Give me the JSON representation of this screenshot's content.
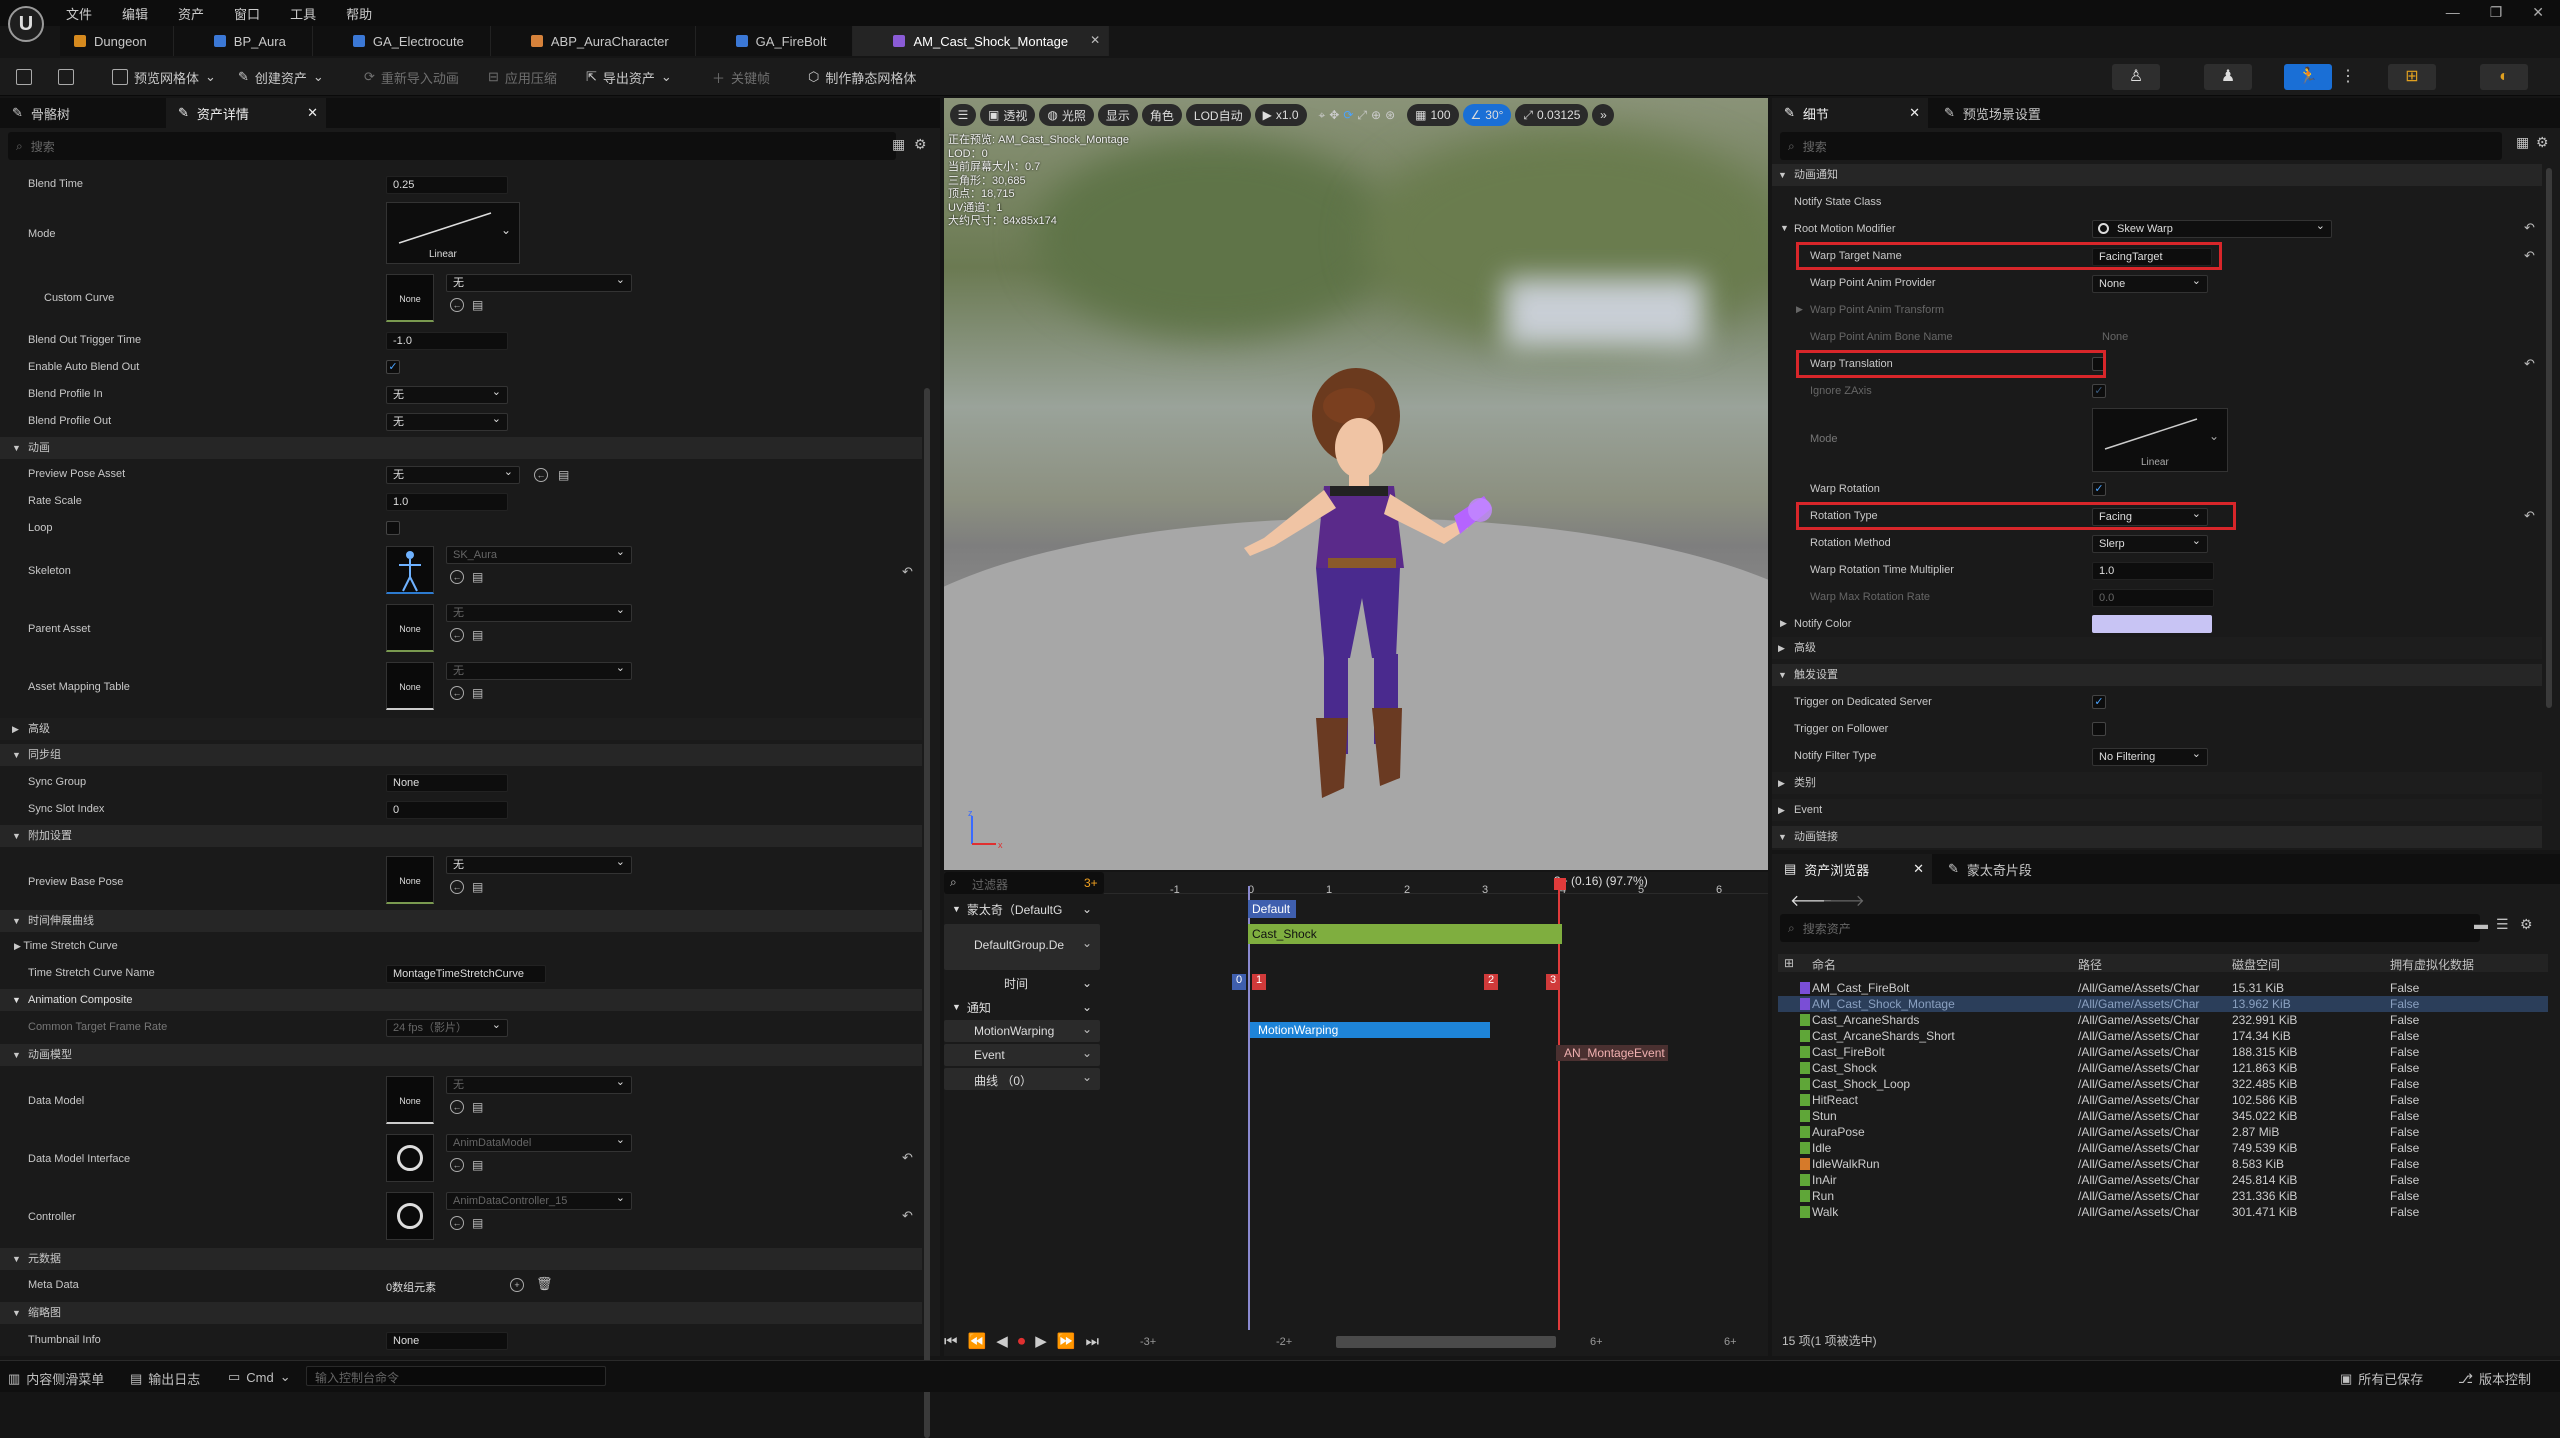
{
  "menu": {
    "items": [
      "文件",
      "编辑",
      "资产",
      "窗口",
      "工具",
      "帮助"
    ]
  },
  "tabs": [
    {
      "label": "Dungeon",
      "color": "#d68a1e"
    },
    {
      "label": "BP_Aura",
      "color": "#3b78d6"
    },
    {
      "label": "GA_Electrocute",
      "color": "#3b78d6"
    },
    {
      "label": "ABP_AuraCharacter",
      "color": "#d6823b"
    },
    {
      "label": "GA_FireBolt",
      "color": "#3b78d6"
    },
    {
      "label": "AM_Cast_Shock_Montage",
      "color": "#8a5bd6"
    }
  ],
  "toolbar": {
    "preview_mesh": "预览网格体",
    "create_asset": "创建资产",
    "reimport": "重新导入动画",
    "apply_compression": "应用压缩",
    "export_asset": "导出资产",
    "keyframe": "关键帧",
    "make_static_mesh": "制作静态网格体"
  },
  "left_panel": {
    "tab_skeleton": "骨骼树",
    "tab_details": "资产详情",
    "search_placeholder": "搜索",
    "blend_time_label": "Blend Time",
    "blend_time": "0.25",
    "mode_label": "Mode",
    "mode_value": "Linear",
    "custom_curve_label": "Custom Curve",
    "none_label": "None",
    "none_cn": "无",
    "blend_out_trigger_label": "Blend Out Trigger Time",
    "blend_out_trigger": "-1.0",
    "auto_blend_out_label": "Enable Auto Blend Out",
    "blend_profile_in_label": "Blend Profile In",
    "blend_profile_out_label": "Blend Profile Out",
    "cat_animation": "动画",
    "preview_pose_label": "Preview Pose Asset",
    "rate_scale_label": "Rate Scale",
    "rate_scale": "1.0",
    "loop_label": "Loop",
    "skeleton_label": "Skeleton",
    "skeleton_value": "SK_Aura",
    "parent_asset_label": "Parent Asset",
    "asset_mapping_label": "Asset Mapping Table",
    "cat_advanced": "高级",
    "cat_sync": "同步组",
    "sync_group_label": "Sync Group",
    "sync_group": "None",
    "sync_slot_label": "Sync Slot Index",
    "sync_slot": "0",
    "cat_additive": "附加设置",
    "preview_base_pose_label": "Preview Base Pose",
    "cat_time_stretch": "时间伸展曲线",
    "time_stretch_curve_label": "Time Stretch Curve",
    "time_stretch_name_label": "Time Stretch Curve Name",
    "time_stretch_name": "MontageTimeStretchCurve",
    "cat_anim_composite": "Animation Composite",
    "common_frame_rate_label": "Common Target Frame Rate",
    "common_frame_rate": "24 fps（影片）",
    "cat_anim_model": "动画模型",
    "data_model_label": "Data Model",
    "data_model_interface_label": "Data Model Interface",
    "data_model_interface": "AnimDataModel",
    "controller_label": "Controller",
    "controller": "AnimDataController_15",
    "cat_metadata": "元数据",
    "meta_data_label": "Meta Data",
    "meta_data_value": "0数组元素",
    "cat_thumbnail": "缩略图",
    "thumbnail_info_label": "Thumbnail Info",
    "thumbnail_info": "None"
  },
  "viewport": {
    "menu_icon": "hamburger-icon",
    "perspective": "透视",
    "lit": "光照",
    "show": "显示",
    "character": "角色",
    "lod_auto": "LOD自动",
    "play_rate": "x1.0",
    "grid_size": "100",
    "rotation_snap": "30°",
    "camera_speed": "0.03125",
    "stats": [
      "正在预览: AM_Cast_Shock_Montage",
      "LOD：0",
      "当前屏幕大小：0.7",
      "三角形：30,685",
      "顶点：18,715",
      "UV通道：1",
      "大约尺寸：84x85x174"
    ]
  },
  "timeline": {
    "filter_placeholder": "过滤器",
    "filter_count": "3+",
    "montage_track": "蒙太奇（DefaultG",
    "group_track": "DefaultGroup.De",
    "time_track": "时间",
    "notify_track": "通知",
    "motion_warping_track": "MotionWarping",
    "event_track": "Event",
    "curves_track": "曲线 （0）",
    "default_label": "Default",
    "segment_label": "Cast_Shock",
    "notify_state": "MotionWarping",
    "notify_event": "AN_MontageEvent",
    "playhead_label": "3+ (0.16) (97.7%)",
    "ruler_ticks": [
      "-1",
      "0",
      "1",
      "2",
      "3",
      "4",
      "5",
      "6"
    ],
    "section_markers": [
      "0",
      "1",
      "2",
      "3"
    ],
    "transport_labels": [
      "-3+",
      "-2+",
      "6+",
      "6+"
    ]
  },
  "details": {
    "tab_details": "细节",
    "tab_preview_settings": "预览场景设置",
    "search_placeholder": "搜索",
    "cat_anim_notify": "动画通知",
    "notify_state_class_label": "Notify State Class",
    "root_motion_label": "Root Motion Modifier",
    "root_motion_value": "Skew Warp",
    "warp_target_name_label": "Warp Target Name",
    "warp_target_name": "FacingTarget",
    "warp_point_provider_label": "Warp Point Anim Provider",
    "warp_point_provider": "None",
    "warp_point_transform_label": "Warp Point Anim Transform",
    "warp_point_bone_label": "Warp Point Anim Bone Name",
    "warp_point_bone": "None",
    "warp_translation_label": "Warp Translation",
    "ignore_z_label": "Ignore ZAxis",
    "mode_label": "Mode",
    "mode_value": "Linear",
    "warp_rotation_label": "Warp Rotation",
    "rotation_type_label": "Rotation Type",
    "rotation_type": "Facing",
    "rotation_method_label": "Rotation Method",
    "rotation_method": "Slerp",
    "rotation_time_mult_label": "Warp Rotation Time Multiplier",
    "rotation_time_mult": "1.0",
    "max_rotation_rate_label": "Warp Max Rotation Rate",
    "max_rotation_rate": "0.0",
    "notify_color_label": "Notify Color",
    "notify_color": "#c8c4f4",
    "cat_advanced": "高级",
    "cat_trigger": "触发设置",
    "trigger_dedicated_label": "Trigger on Dedicated Server",
    "trigger_follower_label": "Trigger on Follower",
    "notify_filter_label": "Notify Filter Type",
    "notify_filter": "No Filtering",
    "cat_category": "类别",
    "cat_event": "Event",
    "cat_anim_link": "动画链接"
  },
  "asset_browser": {
    "tab_browser": "资产浏览器",
    "tab_montage_sections": "蒙太奇片段",
    "search_placeholder": "搜索资产",
    "col_name": "命名",
    "col_path": "路径",
    "col_size": "磁盘空间",
    "col_virtualized": "拥有虚拟化数据",
    "footer": "15 项(1 项被选中)",
    "rows": [
      {
        "name": "AM_Cast_FireBolt",
        "path": "/All/Game/Assets/Char",
        "size": "15.31 KiB",
        "virt": "False",
        "color": "#7a4ed6"
      },
      {
        "name": "AM_Cast_Shock_Montage",
        "path": "/All/Game/Assets/Char",
        "size": "13.962 KiB",
        "virt": "False",
        "color": "#7a4ed6"
      },
      {
        "name": "Cast_ArcaneShards",
        "path": "/All/Game/Assets/Char",
        "size": "232.991 KiB",
        "virt": "False",
        "color": "#5fa638"
      },
      {
        "name": "Cast_ArcaneShards_Short",
        "path": "/All/Game/Assets/Char",
        "size": "174.34 KiB",
        "virt": "False",
        "color": "#5fa638"
      },
      {
        "name": "Cast_FireBolt",
        "path": "/All/Game/Assets/Char",
        "size": "188.315 KiB",
        "virt": "False",
        "color": "#5fa638"
      },
      {
        "name": "Cast_Shock",
        "path": "/All/Game/Assets/Char",
        "size": "121.863 KiB",
        "virt": "False",
        "color": "#5fa638"
      },
      {
        "name": "Cast_Shock_Loop",
        "path": "/All/Game/Assets/Char",
        "size": "322.485 KiB",
        "virt": "False",
        "color": "#5fa638"
      },
      {
        "name": "HitReact",
        "path": "/All/Game/Assets/Char",
        "size": "102.586 KiB",
        "virt": "False",
        "color": "#5fa638"
      },
      {
        "name": "Stun",
        "path": "/All/Game/Assets/Char",
        "size": "345.022 KiB",
        "virt": "False",
        "color": "#5fa638"
      },
      {
        "name": "AuraPose",
        "path": "/All/Game/Assets/Char",
        "size": "2.87 MiB",
        "virt": "False",
        "color": "#5fa638"
      },
      {
        "name": "Idle",
        "path": "/All/Game/Assets/Char",
        "size": "749.539 KiB",
        "virt": "False",
        "color": "#5fa638"
      },
      {
        "name": "IdleWalkRun",
        "path": "/All/Game/Assets/Char",
        "size": "8.583 KiB",
        "virt": "False",
        "color": "#d67a2a"
      },
      {
        "name": "InAir",
        "path": "/All/Game/Assets/Char",
        "size": "245.814 KiB",
        "virt": "False",
        "color": "#5fa638"
      },
      {
        "name": "Run",
        "path": "/All/Game/Assets/Char",
        "size": "231.336 KiB",
        "virt": "False",
        "color": "#5fa638"
      },
      {
        "name": "Walk",
        "path": "/All/Game/Assets/Char",
        "size": "301.471 KiB",
        "virt": "False",
        "color": "#5fa638"
      }
    ]
  },
  "statusbar": {
    "content_drawer": "内容侧滑菜单",
    "output_log": "输出日志",
    "cmd": "Cmd",
    "cmd_placeholder": "输入控制台命令",
    "all_saved": "所有已保存",
    "version_control": "版本控制"
  }
}
